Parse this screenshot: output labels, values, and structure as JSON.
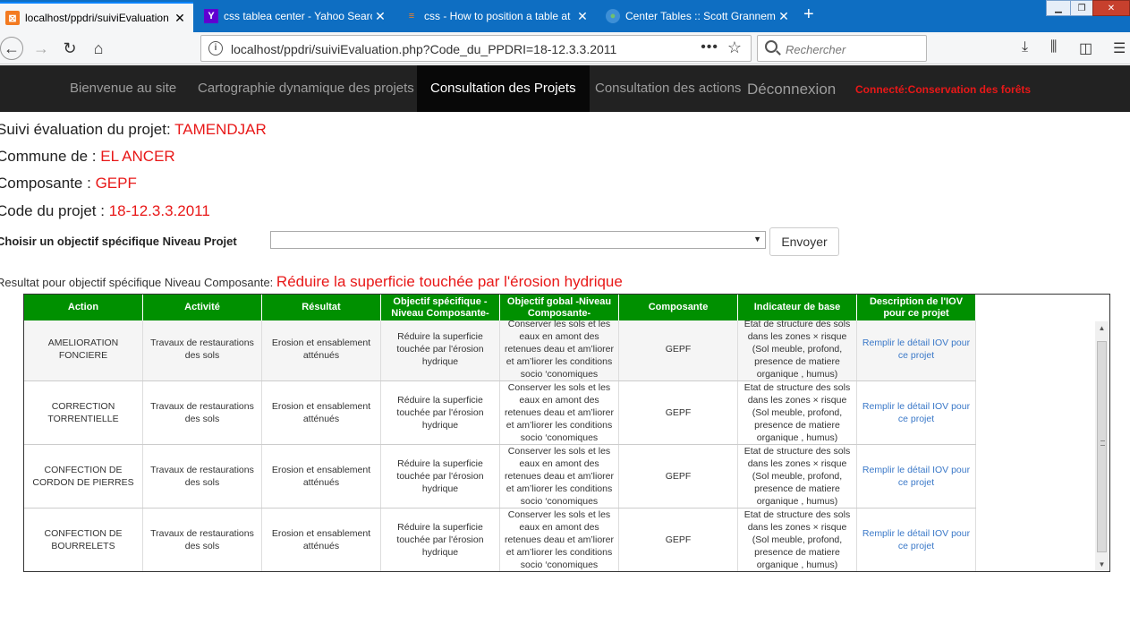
{
  "browser": {
    "tabs": [
      {
        "title": "localhost/ppdri/suiviEvaluation",
        "icon": "xampp-icon"
      },
      {
        "title": "css tablea center - Yahoo Searc",
        "icon": "yahoo-icon"
      },
      {
        "title": "css - How to position a table at",
        "icon": "stackoverflow-icon"
      },
      {
        "title": "Center Tables :: Scott Grannem",
        "icon": "globe-icon"
      }
    ],
    "url_host": "localhost",
    "url_path": "/ppdri/suiviEvaluation.php?Code_du_PPDRI=18-12.3.3.2011",
    "search_placeholder": "Rechercher"
  },
  "sitenav": {
    "items": [
      "Bienvenue au site",
      "Cartographie dynamique des projets",
      "Consultation des Projets",
      "Consultation des actions"
    ],
    "active_index": 2,
    "logout": "Déconnexion",
    "connected": "Connecté:Conservation des forêts"
  },
  "project": {
    "suivi_label": "Suivi évaluation du projet:",
    "suivi_value": "TAMENDJAR",
    "commune_label": "Commune de :",
    "commune_value": "EL ANCER",
    "composante_label": "Composante :",
    "composante_value": "GEPF",
    "code_label": "Code du projet :",
    "code_value": "18-12.3.3.2011"
  },
  "form": {
    "choose_label": "Choisir un objectif spécifique Niveau Projet",
    "select_value": "",
    "submit_label": "Envoyer"
  },
  "result": {
    "label": "Resultat pour objectif spécifique Niveau Composante:",
    "value": "Réduire la superficie touchée par l'érosion hydrique"
  },
  "table": {
    "headers": [
      "Action",
      "Activité",
      "Résultat",
      "Objectif spécifique -Niveau Composante-",
      "Objectif gobal -Niveau Composante-",
      "Composante",
      "Indicateur de base",
      "Description de l'IOV pour ce projet"
    ],
    "rows": [
      [
        "AMELIORATION FONCIERE",
        "Travaux de restaurations des sols",
        "Erosion et ensablement atténués",
        "Réduire la superficie touchée par l'érosion hydrique",
        "Conserver les sols et les eaux en amont des retenues deau et am’liorer et am’liorer les conditions socio ‘conomiques",
        "GEPF",
        "Etat de structure des sols dans les zones × risque (Sol meuble, profond, presence de matiere organique , humus)",
        "Remplir le détail IOV pour ce projet"
      ],
      [
        "CORRECTION TORRENTIELLE",
        "Travaux de restaurations des sols",
        "Erosion et ensablement atténués",
        "Réduire la superficie touchée par l'érosion hydrique",
        "Conserver les sols et les eaux en amont des retenues deau et am’liorer et am’liorer les conditions socio ‘conomiques",
        "GEPF",
        "Etat de structure des sols dans les zones × risque (Sol meuble, profond, presence de matiere organique , humus)",
        "Remplir le détail IOV pour ce projet"
      ],
      [
        "CONFECTION DE CORDON DE PIERRES",
        "Travaux de restaurations des sols",
        "Erosion et ensablement atténués",
        "Réduire la superficie touchée par l'érosion hydrique",
        "Conserver les sols et les eaux en amont des retenues deau et am’liorer et am’liorer les conditions socio ‘conomiques",
        "GEPF",
        "Etat de structure des sols dans les zones × risque (Sol meuble, profond, presence de matiere organique , humus)",
        "Remplir le détail IOV pour ce projet"
      ],
      [
        "CONFECTION DE BOURRELETS",
        "Travaux de restaurations des sols",
        "Erosion et ensablement atténués",
        "Réduire la superficie touchée par l'érosion hydrique",
        "Conserver les sols et les eaux en amont des retenues deau et am’liorer et am’liorer les conditions socio ‘conomiques",
        "GEPF",
        "Etat de structure des sols dans les zones × risque (Sol meuble, profond, presence de matiere organique , humus)",
        "Remplir le détail IOV pour ce projet"
      ]
    ]
  },
  "colors": {
    "accent_red": "#e81818",
    "header_green": "#009000",
    "nav_dark": "#222222",
    "link_blue": "#3a78c8"
  }
}
